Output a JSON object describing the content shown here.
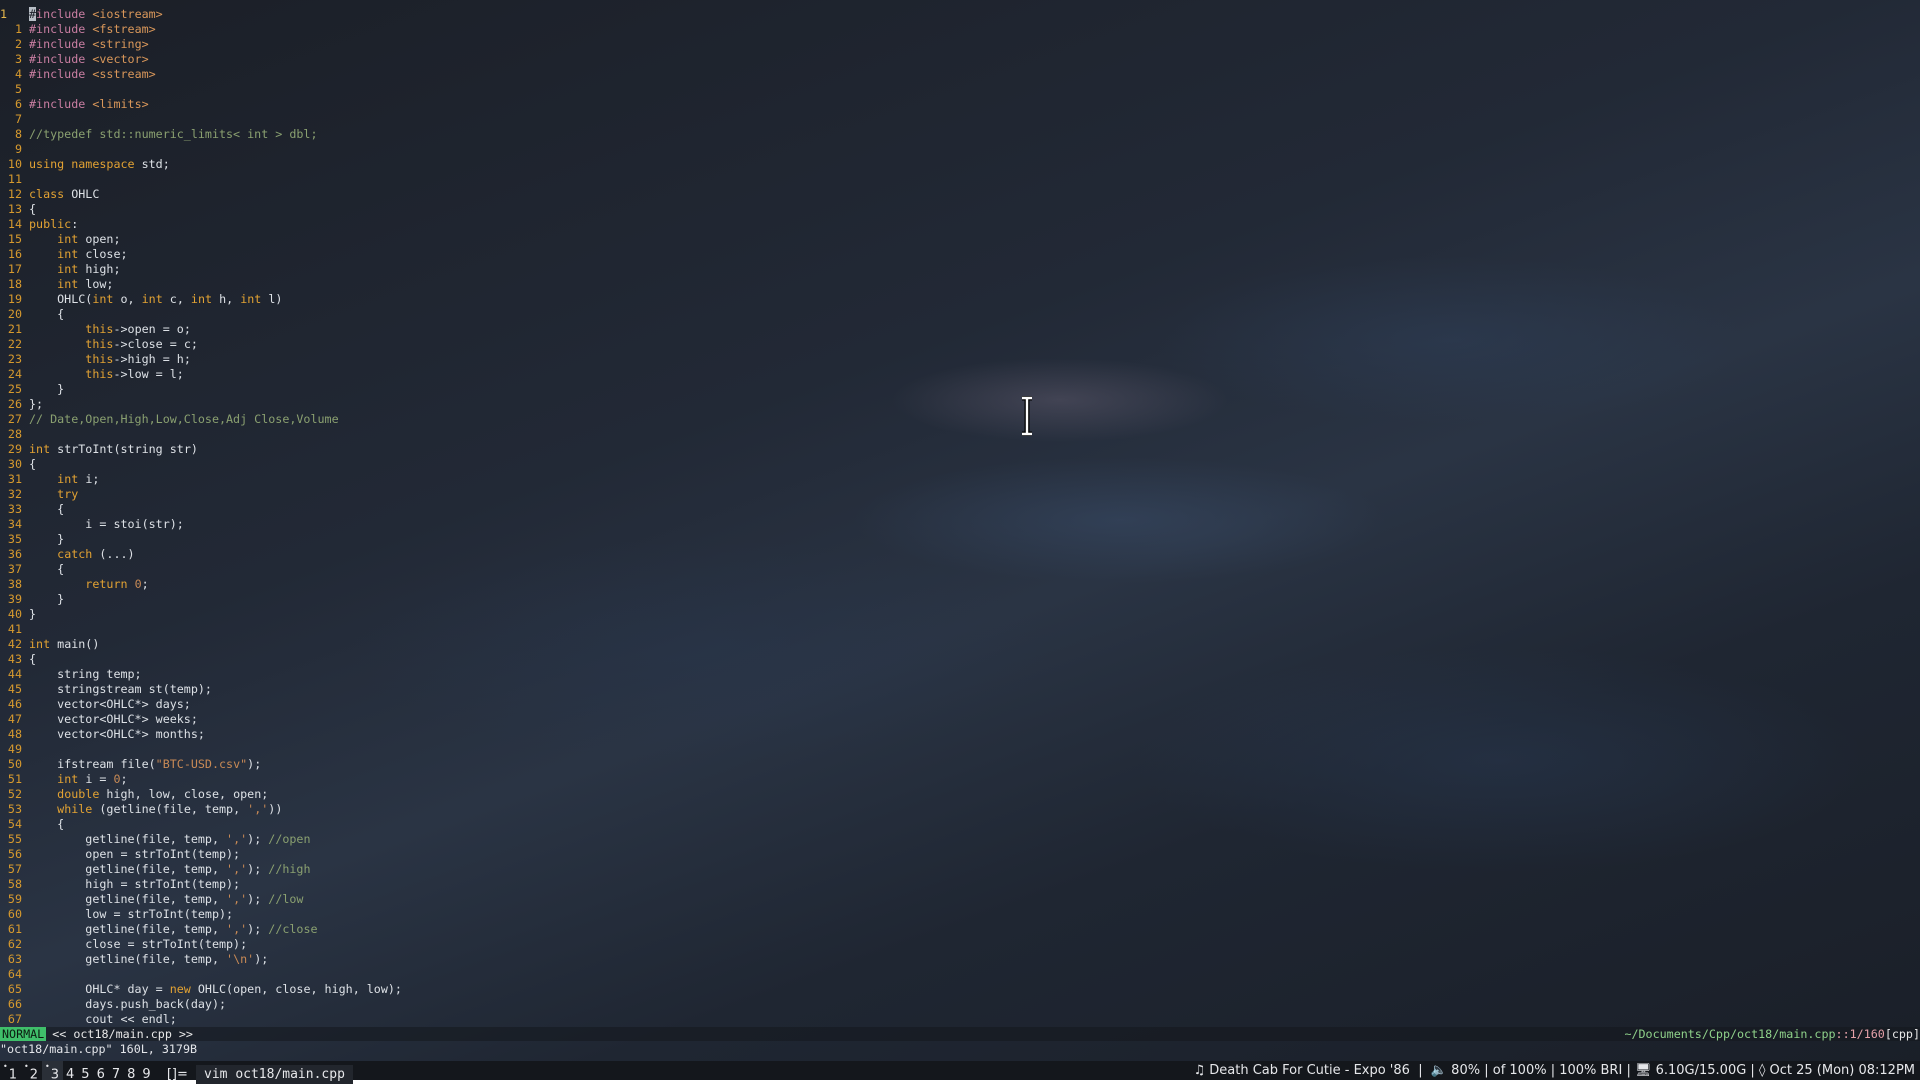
{
  "editor": {
    "current_line_number": "1",
    "lines": [
      {
        "n": "1",
        "segs": [
          {
            "c": "cursor",
            "t": "#"
          },
          {
            "c": "pre",
            "t": "include "
          },
          {
            "c": "inc",
            "t": "<iostream>"
          }
        ]
      },
      {
        "n": "1",
        "segs": [
          {
            "c": "pre",
            "t": "#include "
          },
          {
            "c": "inc",
            "t": "<fstream>"
          }
        ]
      },
      {
        "n": "2",
        "segs": [
          {
            "c": "pre",
            "t": "#include "
          },
          {
            "c": "inc",
            "t": "<string>"
          }
        ]
      },
      {
        "n": "3",
        "segs": [
          {
            "c": "pre",
            "t": "#include "
          },
          {
            "c": "inc",
            "t": "<vector>"
          }
        ]
      },
      {
        "n": "4",
        "segs": [
          {
            "c": "pre",
            "t": "#include "
          },
          {
            "c": "inc",
            "t": "<sstream>"
          }
        ]
      },
      {
        "n": "5",
        "segs": []
      },
      {
        "n": "6",
        "segs": [
          {
            "c": "pre",
            "t": "#include "
          },
          {
            "c": "inc",
            "t": "<limits>"
          }
        ]
      },
      {
        "n": "7",
        "segs": []
      },
      {
        "n": "8",
        "segs": [
          {
            "c": "com",
            "t": "//typedef std::numeric_limits< int > dbl;"
          }
        ]
      },
      {
        "n": "9",
        "segs": []
      },
      {
        "n": "10",
        "segs": [
          {
            "c": "kw",
            "t": "using namespace"
          },
          {
            "c": "",
            "t": " std;"
          }
        ]
      },
      {
        "n": "11",
        "segs": []
      },
      {
        "n": "12",
        "segs": [
          {
            "c": "kw",
            "t": "class"
          },
          {
            "c": "",
            "t": " OHLC"
          }
        ]
      },
      {
        "n": "13",
        "segs": [
          {
            "c": "",
            "t": "{"
          }
        ]
      },
      {
        "n": "14",
        "segs": [
          {
            "c": "kw",
            "t": "public"
          },
          {
            "c": "",
            "t": ":"
          }
        ]
      },
      {
        "n": "15",
        "segs": [
          {
            "c": "",
            "t": "    "
          },
          {
            "c": "kw",
            "t": "int"
          },
          {
            "c": "",
            "t": " open;"
          }
        ]
      },
      {
        "n": "16",
        "segs": [
          {
            "c": "",
            "t": "    "
          },
          {
            "c": "kw",
            "t": "int"
          },
          {
            "c": "",
            "t": " close;"
          }
        ]
      },
      {
        "n": "17",
        "segs": [
          {
            "c": "",
            "t": "    "
          },
          {
            "c": "kw",
            "t": "int"
          },
          {
            "c": "",
            "t": " high;"
          }
        ]
      },
      {
        "n": "18",
        "segs": [
          {
            "c": "",
            "t": "    "
          },
          {
            "c": "kw",
            "t": "int"
          },
          {
            "c": "",
            "t": " low;"
          }
        ]
      },
      {
        "n": "19",
        "segs": [
          {
            "c": "",
            "t": "    OHLC("
          },
          {
            "c": "kw",
            "t": "int"
          },
          {
            "c": "",
            "t": " o, "
          },
          {
            "c": "kw",
            "t": "int"
          },
          {
            "c": "",
            "t": " c, "
          },
          {
            "c": "kw",
            "t": "int"
          },
          {
            "c": "",
            "t": " h, "
          },
          {
            "c": "kw",
            "t": "int"
          },
          {
            "c": "",
            "t": " l)"
          }
        ]
      },
      {
        "n": "20",
        "segs": [
          {
            "c": "",
            "t": "    {"
          }
        ]
      },
      {
        "n": "21",
        "segs": [
          {
            "c": "",
            "t": "        "
          },
          {
            "c": "kw",
            "t": "this"
          },
          {
            "c": "",
            "t": "->open = o;"
          }
        ]
      },
      {
        "n": "22",
        "segs": [
          {
            "c": "",
            "t": "        "
          },
          {
            "c": "kw",
            "t": "this"
          },
          {
            "c": "",
            "t": "->close = c;"
          }
        ]
      },
      {
        "n": "23",
        "segs": [
          {
            "c": "",
            "t": "        "
          },
          {
            "c": "kw",
            "t": "this"
          },
          {
            "c": "",
            "t": "->high = h;"
          }
        ]
      },
      {
        "n": "24",
        "segs": [
          {
            "c": "",
            "t": "        "
          },
          {
            "c": "kw",
            "t": "this"
          },
          {
            "c": "",
            "t": "->low = l;"
          }
        ]
      },
      {
        "n": "25",
        "segs": [
          {
            "c": "",
            "t": "    }"
          }
        ]
      },
      {
        "n": "26",
        "segs": [
          {
            "c": "",
            "t": "};"
          }
        ]
      },
      {
        "n": "27",
        "segs": [
          {
            "c": "com",
            "t": "// Date,Open,High,Low,Close,Adj Close,Volume"
          }
        ]
      },
      {
        "n": "28",
        "segs": []
      },
      {
        "n": "29",
        "segs": [
          {
            "c": "kw",
            "t": "int"
          },
          {
            "c": "",
            "t": " strToInt(string str)"
          }
        ]
      },
      {
        "n": "30",
        "segs": [
          {
            "c": "",
            "t": "{"
          }
        ]
      },
      {
        "n": "31",
        "segs": [
          {
            "c": "",
            "t": "    "
          },
          {
            "c": "kw",
            "t": "int"
          },
          {
            "c": "",
            "t": " i;"
          }
        ]
      },
      {
        "n": "32",
        "segs": [
          {
            "c": "",
            "t": "    "
          },
          {
            "c": "kw",
            "t": "try"
          }
        ]
      },
      {
        "n": "33",
        "segs": [
          {
            "c": "",
            "t": "    {"
          }
        ]
      },
      {
        "n": "34",
        "segs": [
          {
            "c": "",
            "t": "        i = stoi(str);"
          }
        ]
      },
      {
        "n": "35",
        "segs": [
          {
            "c": "",
            "t": "    }"
          }
        ]
      },
      {
        "n": "36",
        "segs": [
          {
            "c": "",
            "t": "    "
          },
          {
            "c": "kw",
            "t": "catch"
          },
          {
            "c": "",
            "t": " (...)"
          }
        ]
      },
      {
        "n": "37",
        "segs": [
          {
            "c": "",
            "t": "    {"
          }
        ]
      },
      {
        "n": "38",
        "segs": [
          {
            "c": "",
            "t": "        "
          },
          {
            "c": "kw",
            "t": "return"
          },
          {
            "c": "",
            "t": " "
          },
          {
            "c": "num",
            "t": "0"
          },
          {
            "c": "",
            "t": ";"
          }
        ]
      },
      {
        "n": "39",
        "segs": [
          {
            "c": "",
            "t": "    }"
          }
        ]
      },
      {
        "n": "40",
        "segs": [
          {
            "c": "",
            "t": "}"
          }
        ]
      },
      {
        "n": "41",
        "segs": []
      },
      {
        "n": "42",
        "segs": [
          {
            "c": "kw",
            "t": "int"
          },
          {
            "c": "",
            "t": " main()"
          }
        ]
      },
      {
        "n": "43",
        "segs": [
          {
            "c": "",
            "t": "{"
          }
        ]
      },
      {
        "n": "44",
        "segs": [
          {
            "c": "",
            "t": "    string temp;"
          }
        ]
      },
      {
        "n": "45",
        "segs": [
          {
            "c": "",
            "t": "    stringstream st(temp);"
          }
        ]
      },
      {
        "n": "46",
        "segs": [
          {
            "c": "",
            "t": "    vector<OHLC*> days;"
          }
        ]
      },
      {
        "n": "47",
        "segs": [
          {
            "c": "",
            "t": "    vector<OHLC*> weeks;"
          }
        ]
      },
      {
        "n": "48",
        "segs": [
          {
            "c": "",
            "t": "    vector<OHLC*> months;"
          }
        ]
      },
      {
        "n": "49",
        "segs": []
      },
      {
        "n": "50",
        "segs": [
          {
            "c": "",
            "t": "    ifstream file("
          },
          {
            "c": "str",
            "t": "\"BTC-USD.csv\""
          },
          {
            "c": "",
            "t": ");"
          }
        ]
      },
      {
        "n": "51",
        "segs": [
          {
            "c": "",
            "t": "    "
          },
          {
            "c": "kw",
            "t": "int"
          },
          {
            "c": "",
            "t": " i = "
          },
          {
            "c": "num",
            "t": "0"
          },
          {
            "c": "",
            "t": ";"
          }
        ]
      },
      {
        "n": "52",
        "segs": [
          {
            "c": "",
            "t": "    "
          },
          {
            "c": "kw",
            "t": "double"
          },
          {
            "c": "",
            "t": " high, low, close, open;"
          }
        ]
      },
      {
        "n": "53",
        "segs": [
          {
            "c": "",
            "t": "    "
          },
          {
            "c": "kw",
            "t": "while"
          },
          {
            "c": "",
            "t": " (getline(file, temp, "
          },
          {
            "c": "str",
            "t": "','"
          },
          {
            "c": "",
            "t": "))"
          }
        ]
      },
      {
        "n": "54",
        "segs": [
          {
            "c": "",
            "t": "    {"
          }
        ]
      },
      {
        "n": "55",
        "segs": [
          {
            "c": "",
            "t": "        getline(file, temp, "
          },
          {
            "c": "str",
            "t": "','"
          },
          {
            "c": "",
            "t": "); "
          },
          {
            "c": "com",
            "t": "//open"
          }
        ]
      },
      {
        "n": "56",
        "segs": [
          {
            "c": "",
            "t": "        open = strToInt(temp);"
          }
        ]
      },
      {
        "n": "57",
        "segs": [
          {
            "c": "",
            "t": "        getline(file, temp, "
          },
          {
            "c": "str",
            "t": "','"
          },
          {
            "c": "",
            "t": "); "
          },
          {
            "c": "com",
            "t": "//high"
          }
        ]
      },
      {
        "n": "58",
        "segs": [
          {
            "c": "",
            "t": "        high = strToInt(temp);"
          }
        ]
      },
      {
        "n": "59",
        "segs": [
          {
            "c": "",
            "t": "        getline(file, temp, "
          },
          {
            "c": "str",
            "t": "','"
          },
          {
            "c": "",
            "t": "); "
          },
          {
            "c": "com",
            "t": "//low"
          }
        ]
      },
      {
        "n": "60",
        "segs": [
          {
            "c": "",
            "t": "        low = strToInt(temp);"
          }
        ]
      },
      {
        "n": "61",
        "segs": [
          {
            "c": "",
            "t": "        getline(file, temp, "
          },
          {
            "c": "str",
            "t": "','"
          },
          {
            "c": "",
            "t": "); "
          },
          {
            "c": "com",
            "t": "//close"
          }
        ]
      },
      {
        "n": "62",
        "segs": [
          {
            "c": "",
            "t": "        close = strToInt(temp);"
          }
        ]
      },
      {
        "n": "63",
        "segs": [
          {
            "c": "",
            "t": "        getline(file, temp, "
          },
          {
            "c": "str",
            "t": "'\\n'"
          },
          {
            "c": "",
            "t": ");"
          }
        ]
      },
      {
        "n": "64",
        "segs": []
      },
      {
        "n": "65",
        "segs": [
          {
            "c": "",
            "t": "        OHLC* day = "
          },
          {
            "c": "kw",
            "t": "new"
          },
          {
            "c": "",
            "t": " OHLC(open, close, high, low);"
          }
        ]
      },
      {
        "n": "66",
        "segs": [
          {
            "c": "",
            "t": "        days.push_back(day);"
          }
        ]
      },
      {
        "n": "67",
        "segs": [
          {
            "c": "",
            "t": "        cout << endl;"
          }
        ]
      }
    ]
  },
  "statusline": {
    "mode": "NORMAL",
    "file": "<< oct18/main.cpp >>",
    "path": "~/Documents/Cpp/oct18/main.cpp",
    "position": "::1/160",
    "filetype": "[cpp]"
  },
  "cmdline": {
    "message": "\"oct18/main.cpp\" 160L, 3179B"
  },
  "bar": {
    "workspaces": [
      {
        "sup": "•",
        "label": "1",
        "active": false
      },
      {
        "sup": "•",
        "label": "2",
        "active": false
      },
      {
        "sup": "•",
        "label": "3",
        "active": true
      },
      {
        "sup": "",
        "label": "4",
        "active": false
      },
      {
        "sup": "",
        "label": "5",
        "active": false
      },
      {
        "sup": "",
        "label": "6",
        "active": false
      },
      {
        "sup": "",
        "label": "7",
        "active": false
      },
      {
        "sup": "",
        "label": "8",
        "active": false
      },
      {
        "sup": "",
        "label": "9",
        "active": false
      }
    ],
    "layout": "[]=",
    "window_title": "vim oct18/main.cpp",
    "music": "♫ Death Cab For Cutie - Expo '86",
    "volume": "🔈 80%",
    "brightness_of": "of 100%",
    "brightness": "100% BRI",
    "memory": "🖥 6.10G/15.00G",
    "datetime": "◊ Oct 25 (Mon) 08:12PM"
  },
  "colors": {
    "mode_bg": "#3fbf6a",
    "line_number": "#d79a2e",
    "keyword": "#e2a233",
    "comment": "#8aa070",
    "preprocessor": "#c97ea2"
  }
}
